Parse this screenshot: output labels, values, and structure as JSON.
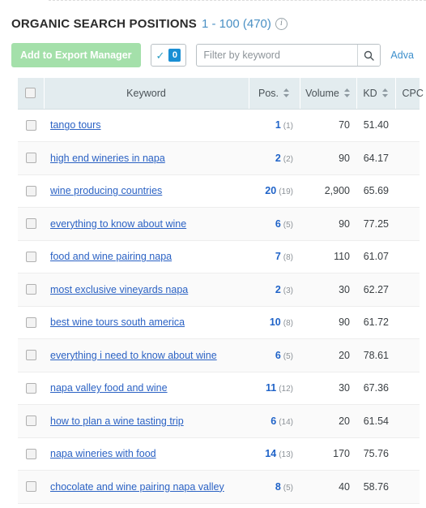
{
  "panel": {
    "title": "ORGANIC SEARCH POSITIONS",
    "range": "1 - 100 (470)",
    "info_icon": "info-icon"
  },
  "toolbar": {
    "export_label": "Add to Export Manager",
    "selected_count": "0",
    "check_glyph": "✓",
    "filter_placeholder": "Filter by keyword",
    "filter_value": "",
    "search_icon": "search-icon",
    "advanced_label": "Adva"
  },
  "table": {
    "headers": {
      "checkbox": "",
      "keyword": "Keyword",
      "position": "Pos.",
      "volume": "Volume",
      "kd": "KD",
      "cpc": "CPC"
    },
    "rows": [
      {
        "keyword": "tango tours",
        "pos": "1",
        "prev": "(1)",
        "volume": "70",
        "kd": "51.40",
        "cpc": ""
      },
      {
        "keyword": "high end wineries in napa",
        "pos": "2",
        "prev": "(2)",
        "volume": "90",
        "kd": "64.17",
        "cpc": ""
      },
      {
        "keyword": "wine producing countries",
        "pos": "20",
        "prev": "(19)",
        "volume": "2,900",
        "kd": "65.69",
        "cpc": ""
      },
      {
        "keyword": "everything to know about wine",
        "pos": "6",
        "prev": "(5)",
        "volume": "90",
        "kd": "77.25",
        "cpc": ""
      },
      {
        "keyword": "food and wine pairing napa",
        "pos": "7",
        "prev": "(8)",
        "volume": "110",
        "kd": "61.07",
        "cpc": ""
      },
      {
        "keyword": "most exclusive vineyards napa",
        "pos": "2",
        "prev": "(3)",
        "volume": "30",
        "kd": "62.27",
        "cpc": ""
      },
      {
        "keyword": "best wine tours south america",
        "pos": "10",
        "prev": "(8)",
        "volume": "90",
        "kd": "61.72",
        "cpc": ""
      },
      {
        "keyword": "everything i need to know about wine",
        "pos": "6",
        "prev": "(5)",
        "volume": "20",
        "kd": "78.61",
        "cpc": ""
      },
      {
        "keyword": "napa valley food and wine",
        "pos": "11",
        "prev": "(12)",
        "volume": "30",
        "kd": "67.36",
        "cpc": ""
      },
      {
        "keyword": "how to plan a wine tasting trip",
        "pos": "6",
        "prev": "(14)",
        "volume": "20",
        "kd": "61.54",
        "cpc": ""
      },
      {
        "keyword": "napa wineries with food",
        "pos": "14",
        "prev": "(13)",
        "volume": "170",
        "kd": "75.76",
        "cpc": ""
      },
      {
        "keyword": "chocolate and wine pairing napa valley",
        "pos": "8",
        "prev": "(5)",
        "volume": "40",
        "kd": "58.76",
        "cpc": ""
      }
    ]
  },
  "colors": {
    "link": "#2b62c4",
    "position": "#1f63c8",
    "header_bg": "#e3ecef",
    "export_btn": "#a4e0aa",
    "badge": "#1a8fd4"
  }
}
